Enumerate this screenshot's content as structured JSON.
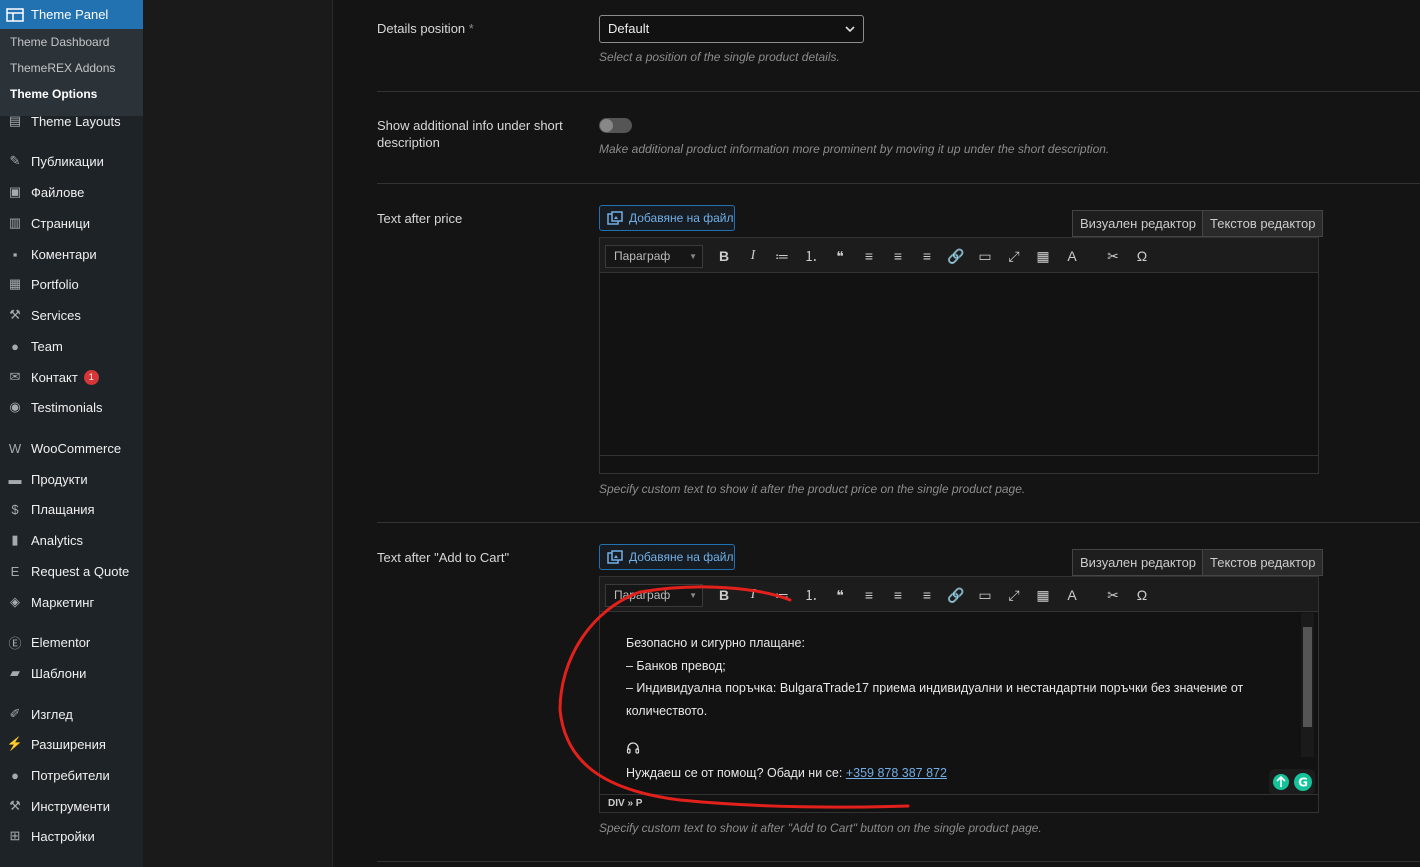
{
  "sidebar": {
    "active": "Theme Panel",
    "submenu": [
      "Theme Dashboard",
      "ThemeREX Addons",
      "Theme Options"
    ],
    "items": [
      {
        "label": "Theme Layouts",
        "icon": "layouts-icon"
      },
      {
        "label": "Публикации",
        "icon": "pin-icon"
      },
      {
        "label": "Файлове",
        "icon": "media-icon"
      },
      {
        "label": "Страници",
        "icon": "pages-icon"
      },
      {
        "label": "Коментари",
        "icon": "comments-icon"
      },
      {
        "label": "Portfolio",
        "icon": "portfolio-icon"
      },
      {
        "label": "Services",
        "icon": "wrench-icon"
      },
      {
        "label": "Team",
        "icon": "user-icon"
      },
      {
        "label": "Контакт",
        "icon": "mail-icon",
        "badge": "1"
      },
      {
        "label": "Testimonials",
        "icon": "speech-icon"
      },
      {
        "label": "WooCommerce",
        "icon": "woo-icon"
      },
      {
        "label": "Продукти",
        "icon": "archive-icon"
      },
      {
        "label": "Плащания",
        "icon": "dollar-icon"
      },
      {
        "label": "Analytics",
        "icon": "bar-chart-icon"
      },
      {
        "label": "Request a Quote",
        "icon": "quote-icon"
      },
      {
        "label": "Маркетинг",
        "icon": "megaphone-icon"
      },
      {
        "label": "Elementor",
        "icon": "elementor-icon"
      },
      {
        "label": "Шаблони",
        "icon": "folder-icon"
      },
      {
        "label": "Изглед",
        "icon": "brush-icon"
      },
      {
        "label": "Разширения",
        "icon": "plugin-icon"
      },
      {
        "label": "Потребители",
        "icon": "users-icon"
      },
      {
        "label": "Инструменти",
        "icon": "tools-icon"
      },
      {
        "label": "Настройки",
        "icon": "settings-icon"
      }
    ]
  },
  "details_position": {
    "label": "Details position",
    "required": "*",
    "value": "Default",
    "desc": "Select a position of the single product details."
  },
  "additional_info": {
    "label": "Show additional info under short description",
    "enabled": false,
    "desc": "Make additional product information more prominent by moving it up under the short description."
  },
  "text_after_price": {
    "label": "Text after price",
    "add_media": "Добавяне на файл",
    "tab_visual": "Визуален редактор",
    "tab_text": "Текстов редактор",
    "format": "Параграф",
    "content": "",
    "desc": "Specify custom text to show it after the product price on the single product page."
  },
  "text_after_cart": {
    "label": "Text after \"Add to Cart\"",
    "add_media": "Добавяне на файл",
    "tab_visual": "Визуален редактор",
    "tab_text": "Текстов редактор",
    "format": "Параграф",
    "lines": [
      "Безопасно и сигурно плащане:",
      "– Банков превод;",
      "– Индивидуална поръчка: BulgaraTrade17 приема индивидуални и нестандартни поръчки без значение от количеството."
    ],
    "help_text": "Нуждаеш се от помощ? Обади ни се: ",
    "phone": "+359 878 387 872",
    "path": "DIV » P",
    "desc": "Specify custom text to show it after \"Add to Cart\" button on the single product page."
  },
  "colors": {
    "accent": "#2271b1",
    "annotation": "#e3211c"
  }
}
